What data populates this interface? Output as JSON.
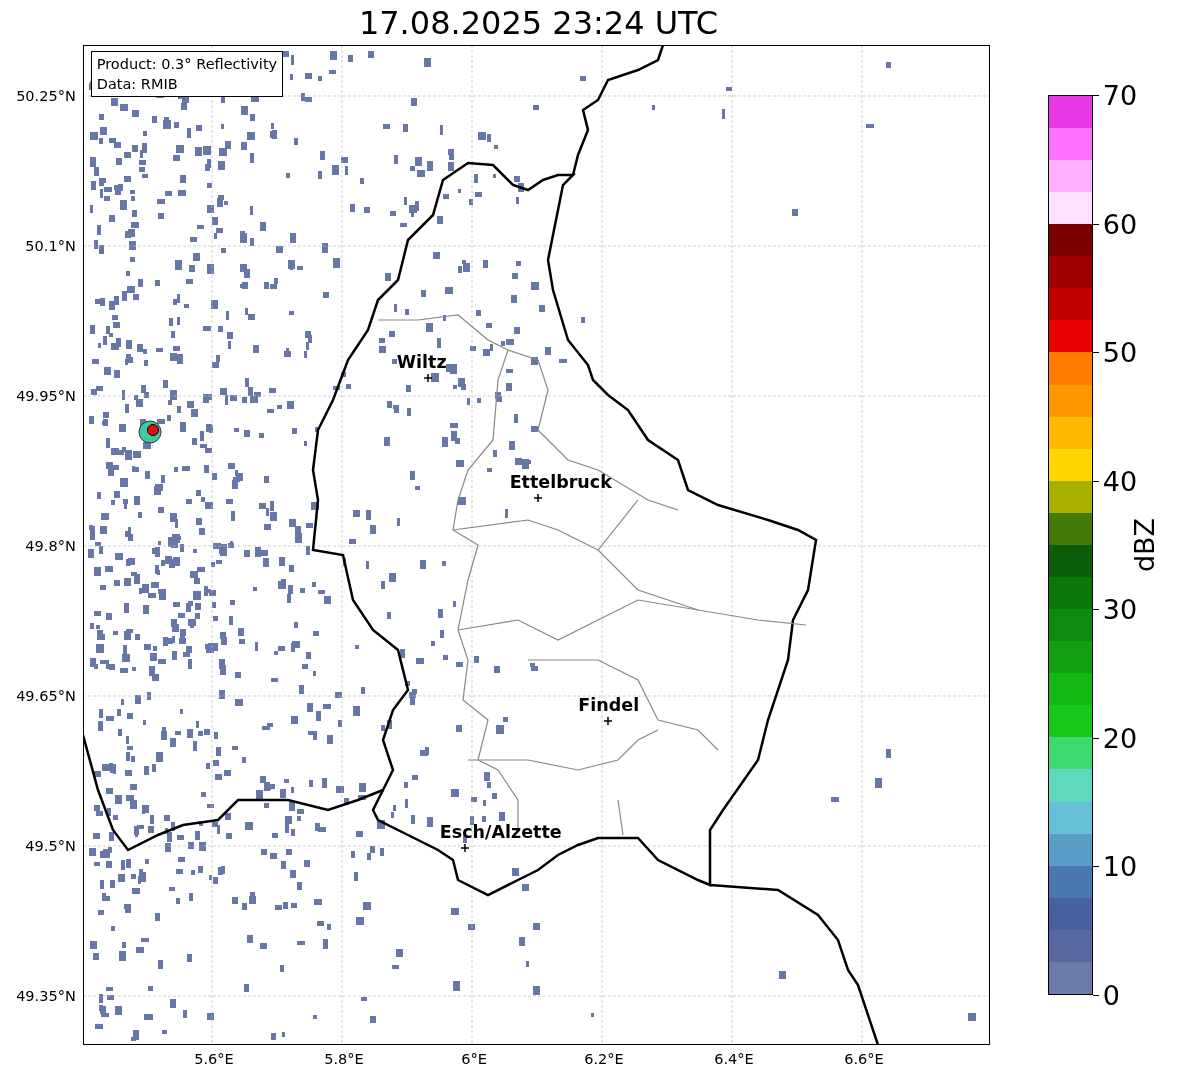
{
  "title": "17.08.2025 23:24 UTC",
  "info_box": {
    "lines": [
      "Product: 0.3° Reflectivity",
      "Data: RMIB"
    ]
  },
  "y_ticks": [
    "50.25°N",
    "50.1°N",
    "49.95°N",
    "49.8°N",
    "49.65°N",
    "49.5°N",
    "49.35°N"
  ],
  "x_ticks": [
    "5.6°E",
    "5.8°E",
    "6°E",
    "6.2°E",
    "6.4°E",
    "6.6°E"
  ],
  "places": [
    {
      "name": "Wiltz"
    },
    {
      "name": "Ettelbruck"
    },
    {
      "name": "Findel"
    },
    {
      "name": "Esch/Alzette"
    }
  ],
  "colorbar": {
    "label": "dBZ",
    "ticks": [
      "70",
      "60",
      "50",
      "40",
      "30",
      "20",
      "10",
      "0"
    ]
  }
}
